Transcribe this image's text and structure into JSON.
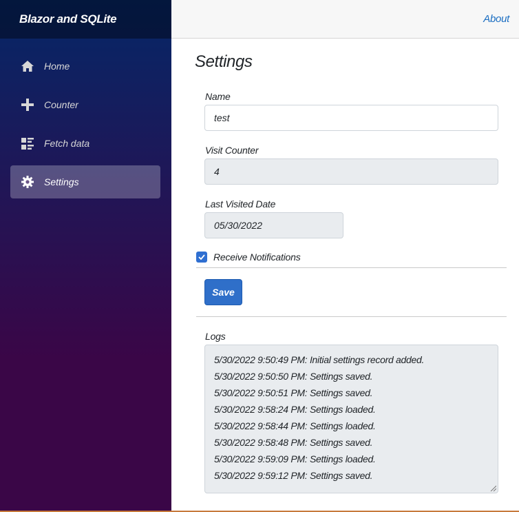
{
  "sidebar": {
    "brand": "Blazor and SQLite",
    "items": [
      {
        "label": "Home",
        "icon": "home-icon",
        "active": false
      },
      {
        "label": "Counter",
        "icon": "plus-icon",
        "active": false
      },
      {
        "label": "Fetch data",
        "icon": "list-icon",
        "active": false
      },
      {
        "label": "Settings",
        "icon": "gear-icon",
        "active": true
      }
    ]
  },
  "header": {
    "about_label": "About"
  },
  "main": {
    "title": "Settings",
    "name_label": "Name",
    "name_value": "test",
    "visit_counter_label": "Visit Counter",
    "visit_counter_value": "4",
    "last_visited_label": "Last Visited Date",
    "last_visited_value": "05/30/2022",
    "notifications_label": "Receive Notifications",
    "notifications_checked": true,
    "save_label": "Save",
    "logs_label": "Logs",
    "logs": [
      "5/30/2022 9:50:49 PM: Initial settings record added.",
      "5/30/2022 9:50:50 PM: Settings saved.",
      "5/30/2022 9:50:51 PM: Settings saved.",
      "5/30/2022 9:58:24 PM: Settings loaded.",
      "5/30/2022 9:58:44 PM: Settings loaded.",
      "5/30/2022 9:58:48 PM: Settings saved.",
      "5/30/2022 9:59:09 PM: Settings loaded.",
      "5/30/2022 9:59:12 PM: Settings saved."
    ]
  },
  "colors": {
    "accent": "#2f6fc9",
    "link": "#1b6ec2",
    "sidebar_top": "#052767",
    "sidebar_bottom": "#3a0647"
  }
}
